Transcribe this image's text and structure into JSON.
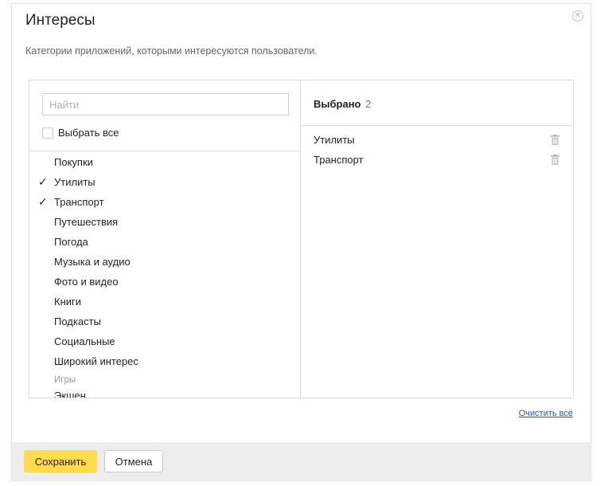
{
  "dialog": {
    "title": "Интересы",
    "subtitle": "Категории приложений, которыми интересуются пользователи.",
    "close_icon": "close-icon"
  },
  "left": {
    "search_placeholder": "Найти",
    "select_all_label": "Выбрать все",
    "items": [
      {
        "label": "Покупки",
        "checked": false
      },
      {
        "label": "Утилиты",
        "checked": true
      },
      {
        "label": "Транспорт",
        "checked": true
      },
      {
        "label": "Путешествия",
        "checked": false
      },
      {
        "label": "Погода",
        "checked": false
      },
      {
        "label": "Музыка и аудио",
        "checked": false
      },
      {
        "label": "Фото и видео",
        "checked": false
      },
      {
        "label": "Книги",
        "checked": false
      },
      {
        "label": "Подкасты",
        "checked": false
      },
      {
        "label": "Социальные",
        "checked": false
      },
      {
        "label": "Широкий интерес",
        "checked": false
      }
    ],
    "group_label": "Игры",
    "group_items": [
      {
        "label": "Экшен",
        "checked": false
      }
    ],
    "check_mark": "✓"
  },
  "right": {
    "header_label": "Выбрано",
    "header_count": "2",
    "selected": [
      {
        "label": "Утилиты",
        "icon": "trash-icon"
      },
      {
        "label": "Транспорт",
        "icon": "trash-icon"
      }
    ]
  },
  "clear_all_label": "Очистить всё",
  "footer": {
    "save_label": "Сохранить",
    "cancel_label": "Отмена"
  },
  "colors": {
    "save_button": "#ffdb4d",
    "link": "#1a5fb4",
    "footer_bg": "#ededed"
  }
}
